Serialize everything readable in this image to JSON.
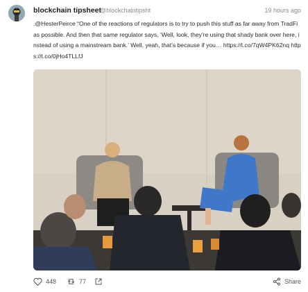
{
  "post": {
    "author_name": "blockchain tipsheet",
    "author_handle": "@blockchaintipsht",
    "timestamp": "19 hours ago",
    "text": ".@HesterPeirce “One of the reactions of regulators is to try to push this stuff as far away from TradFi as possible. And then that same regulator says, ‘Well, look, they're using that shady bank over here, instead of using a mainstream bank.’ Well, yeah, that's because if you… https://t.co/7qW4PK62nq https://t.co/0jHo4TLLfJ"
  },
  "actions": {
    "likes": "448",
    "retweets": "77",
    "share_label": "Share"
  },
  "icons": {
    "avatar": "avatar-icon",
    "like": "heart-icon",
    "retweet": "retweet-icon",
    "external": "external-link-icon",
    "share": "share-icon"
  },
  "colors": {
    "text": "#2a2a2a",
    "muted": "#8a8a8a",
    "wall": "#d9d2c4"
  }
}
